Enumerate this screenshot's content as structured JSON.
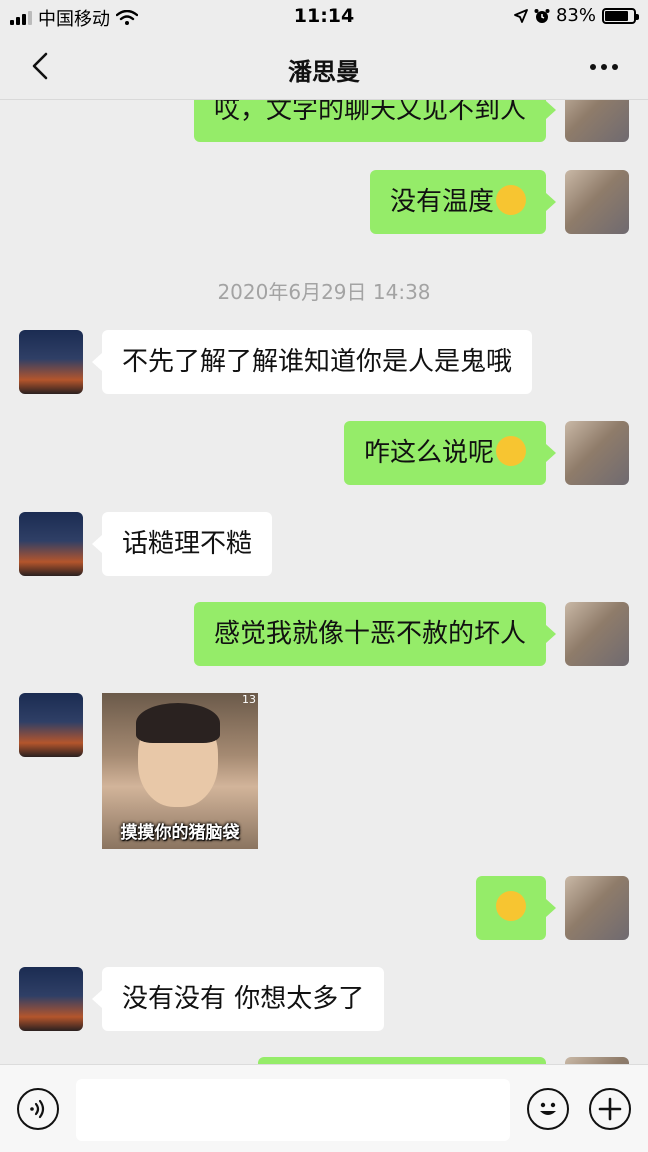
{
  "status_bar": {
    "carrier": "中国移动",
    "time": "11:14",
    "battery": "83%",
    "battery_level": 0.83
  },
  "nav": {
    "title": "潘思曼"
  },
  "messages": [
    {
      "from": "me",
      "text": "哎，文字的聊天又见不到人",
      "emoji": ""
    },
    {
      "from": "me",
      "text": "没有温度",
      "emoji": "weary-face"
    },
    {
      "timestamp": "2020年6月29日 14:38"
    },
    {
      "from": "them",
      "text": "不先了解了解谁知道你是人是鬼哦",
      "emoji": ""
    },
    {
      "from": "me",
      "text": "咋这么说呢",
      "emoji": "pleading-face"
    },
    {
      "from": "them",
      "text": "话糙理不糙",
      "emoji": ""
    },
    {
      "from": "me",
      "text": "感觉我就像十恶不赦的坏人",
      "emoji": ""
    },
    {
      "from": "them",
      "sticker": {
        "caption": "摸摸你的猪脑袋",
        "corner": "13"
      }
    },
    {
      "from": "me",
      "text": "",
      "emoji": "sweat-face"
    },
    {
      "from": "them",
      "text": "没有没有 你想太多了",
      "emoji": ""
    }
  ],
  "input": {
    "value": "",
    "placeholder": ""
  },
  "colors": {
    "background": "#ededed",
    "my_bubble": "#95ec69",
    "their_bubble": "#ffffff",
    "timestamp": "#a3a3a3"
  },
  "icons": [
    "back-chevron-icon",
    "more-dots-icon",
    "voice-icon",
    "emoji-icon",
    "plus-icon"
  ]
}
